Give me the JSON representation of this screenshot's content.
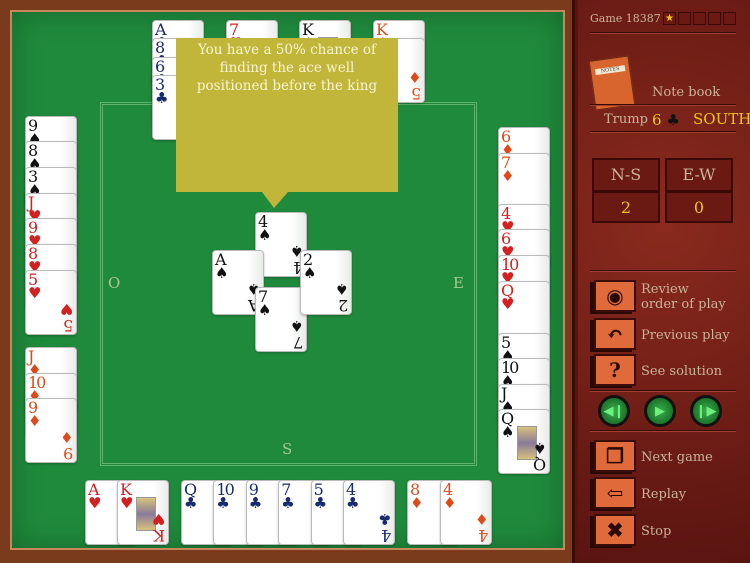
{
  "hands": {
    "north": [
      [
        "A",
        "♣"
      ],
      [
        "8",
        "♣"
      ],
      [
        "6",
        "♣"
      ],
      [
        "3",
        "♣"
      ]
    ],
    "north2": [
      [
        "7",
        "♥"
      ]
    ],
    "north3": [
      [
        "K",
        "♠"
      ]
    ],
    "north4": [
      [
        "K",
        "♦"
      ],
      [
        "5",
        "♦"
      ]
    ],
    "west1": [
      [
        "9",
        "♠"
      ],
      [
        "8",
        "♠"
      ],
      [
        "3",
        "♠"
      ],
      [
        "J",
        "♥"
      ],
      [
        "9",
        "♥"
      ],
      [
        "8",
        "♥"
      ],
      [
        "5",
        "♥"
      ]
    ],
    "west2": [
      [
        "J",
        "♦"
      ],
      [
        "10",
        "♦"
      ],
      [
        "9",
        "♦"
      ]
    ],
    "east": [
      [
        "6",
        "♦"
      ],
      [
        "7",
        "♦"
      ],
      [
        "4",
        "♥"
      ],
      [
        "6",
        "♥"
      ],
      [
        "10",
        "♥"
      ],
      [
        "Q",
        "♥"
      ],
      [
        "5",
        "♠"
      ],
      [
        "10",
        "♠"
      ],
      [
        "J",
        "♠"
      ],
      [
        "Q",
        "♠"
      ]
    ],
    "south1": [
      [
        "A",
        "♥"
      ],
      [
        "K",
        "♥"
      ]
    ],
    "south2": [
      [
        "Q",
        "♣"
      ],
      [
        "10",
        "♣"
      ],
      [
        "9",
        "♣"
      ],
      [
        "7",
        "♣"
      ],
      [
        "5",
        "♣"
      ],
      [
        "4",
        "♣"
      ]
    ],
    "south3": [
      [
        "8",
        "♦"
      ],
      [
        "4",
        "♦"
      ]
    ]
  },
  "trick": {
    "north": [
      "4",
      "♠"
    ],
    "east": [
      "2",
      "♠"
    ],
    "west": [
      "A",
      "♠"
    ],
    "south": [
      "7",
      "♠"
    ]
  },
  "seats": {
    "west": "O",
    "east": "E",
    "south": "S"
  },
  "tip": "You have a 50% chance of finding the ace well positioned before the king",
  "panel": {
    "game": "Game 18387",
    "stars_filled": 1,
    "stars_total": 5,
    "star": "★",
    "notebook": "Note book",
    "notes_label": "NOTES",
    "trump_label": "Trump",
    "trump_value": "6",
    "trump_suit": "♣",
    "declarer": "SOUTH",
    "score": {
      "ns_label": "N-S",
      "ew_label": "E-W",
      "ns": "2",
      "ew": "0"
    },
    "buttons": [
      {
        "id": "review",
        "icon": "eye-icon",
        "glyph": "◉",
        "label1": "Review",
        "label2": "order of play"
      },
      {
        "id": "previous",
        "icon": "undo-icon",
        "glyph": "↶",
        "label1": "Previous play"
      },
      {
        "id": "solution",
        "icon": "question-icon",
        "glyph": "?",
        "label1": "See solution"
      },
      {
        "id": "next-game",
        "icon": "cards-icon",
        "glyph": "❐",
        "label1": "Next game"
      },
      {
        "id": "replay",
        "icon": "arrow-left-icon",
        "glyph": "⇦",
        "label1": "Replay"
      },
      {
        "id": "stop",
        "icon": "x-icon",
        "glyph": "✖",
        "label1": "Stop"
      }
    ],
    "nav": [
      {
        "id": "step-back",
        "glyph": "◀❙"
      },
      {
        "id": "play",
        "glyph": "▶"
      },
      {
        "id": "step-forward",
        "glyph": "❙▶"
      }
    ]
  },
  "colors": {
    "felt": "#1f8a3c",
    "bubble": "#c1b53a",
    "accent": "#f0c418",
    "clubs": "#1a2a6e",
    "spades": "#111111",
    "hearts": "#d32020",
    "diamonds": "#e04a1a"
  }
}
